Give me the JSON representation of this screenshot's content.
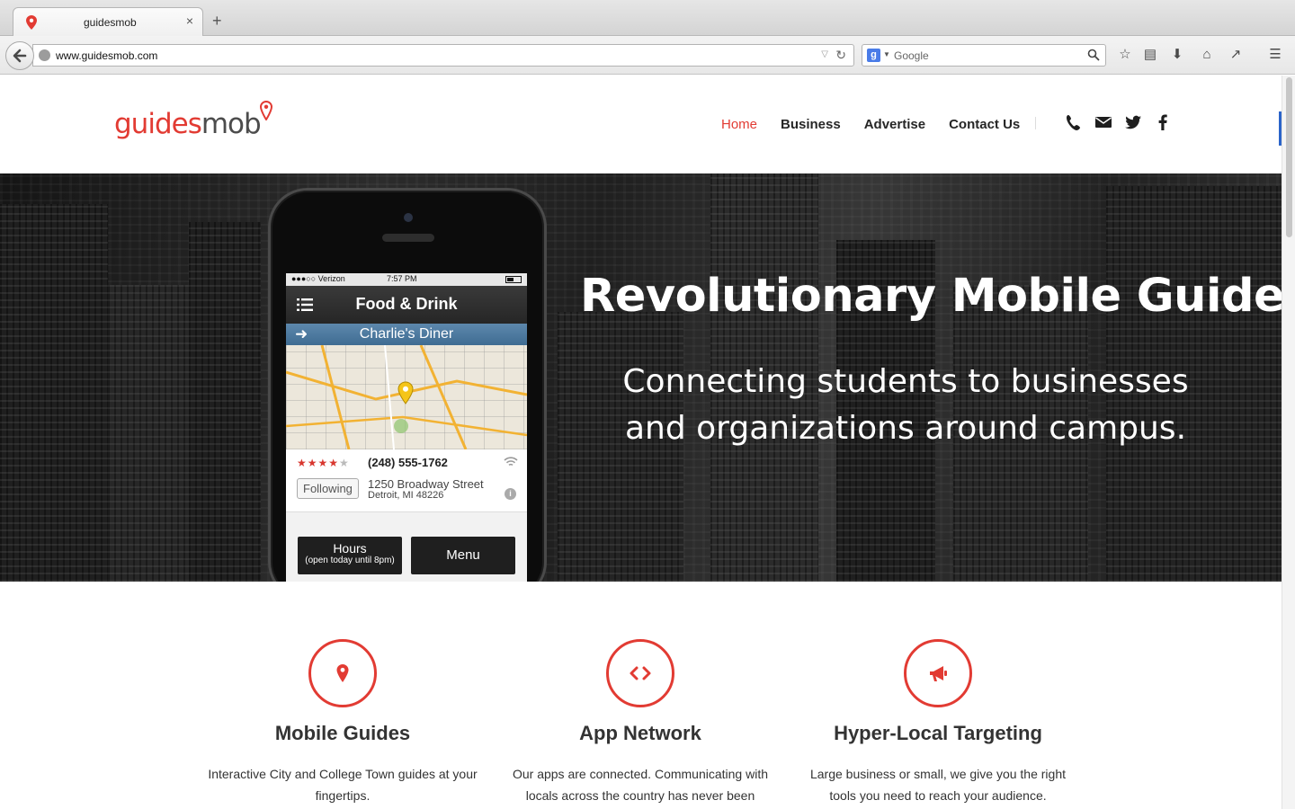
{
  "browser": {
    "tab_title": "guidesmob",
    "tab_close": "×",
    "new_tab": "+",
    "url": "www.guidesmob.com",
    "search_placeholder": "Google",
    "search_engine_icon": "g-icon"
  },
  "site": {
    "logo_part1": "guides",
    "logo_part2": "mob",
    "brand_color": "#e23b33",
    "nav": [
      {
        "label": "Home",
        "active": true
      },
      {
        "label": "Business",
        "active": false
      },
      {
        "label": "Advertise",
        "active": false
      },
      {
        "label": "Contact Us",
        "active": false
      }
    ],
    "social_icons": [
      "phone-icon",
      "mail-icon",
      "twitter-icon",
      "facebook-icon"
    ]
  },
  "hero": {
    "title": "Revolutionary Mobile Guides",
    "subtitle_line1": "Connecting students to businesses",
    "subtitle_line2": "and organizations around campus."
  },
  "phone_app": {
    "carrier": "●●●○○ Verizon",
    "time": "7:57 PM",
    "title": "Food & Drink",
    "place": "Charlie's Diner",
    "rating": 4,
    "rating_max": 5,
    "phone": "(248) 555-1762",
    "following": "Following",
    "address_line1": "1250 Broadway Street",
    "address_line2": "Detroit, MI 48226",
    "hours_label": "Hours",
    "hours_note": "(open today until 8pm)",
    "menu_label": "Menu"
  },
  "features": [
    {
      "icon": "map-pin-icon",
      "title": "Mobile Guides",
      "text": "Interactive City and College Town guides at your fingertips."
    },
    {
      "icon": "code-icon",
      "title": "App Network",
      "text": "Our apps are connected. Communicating with locals  across the country has never been"
    },
    {
      "icon": "megaphone-icon",
      "title": "Hyper-Local Targeting",
      "text": "Large business or small, we give you the right tools you need to reach your audience."
    }
  ]
}
